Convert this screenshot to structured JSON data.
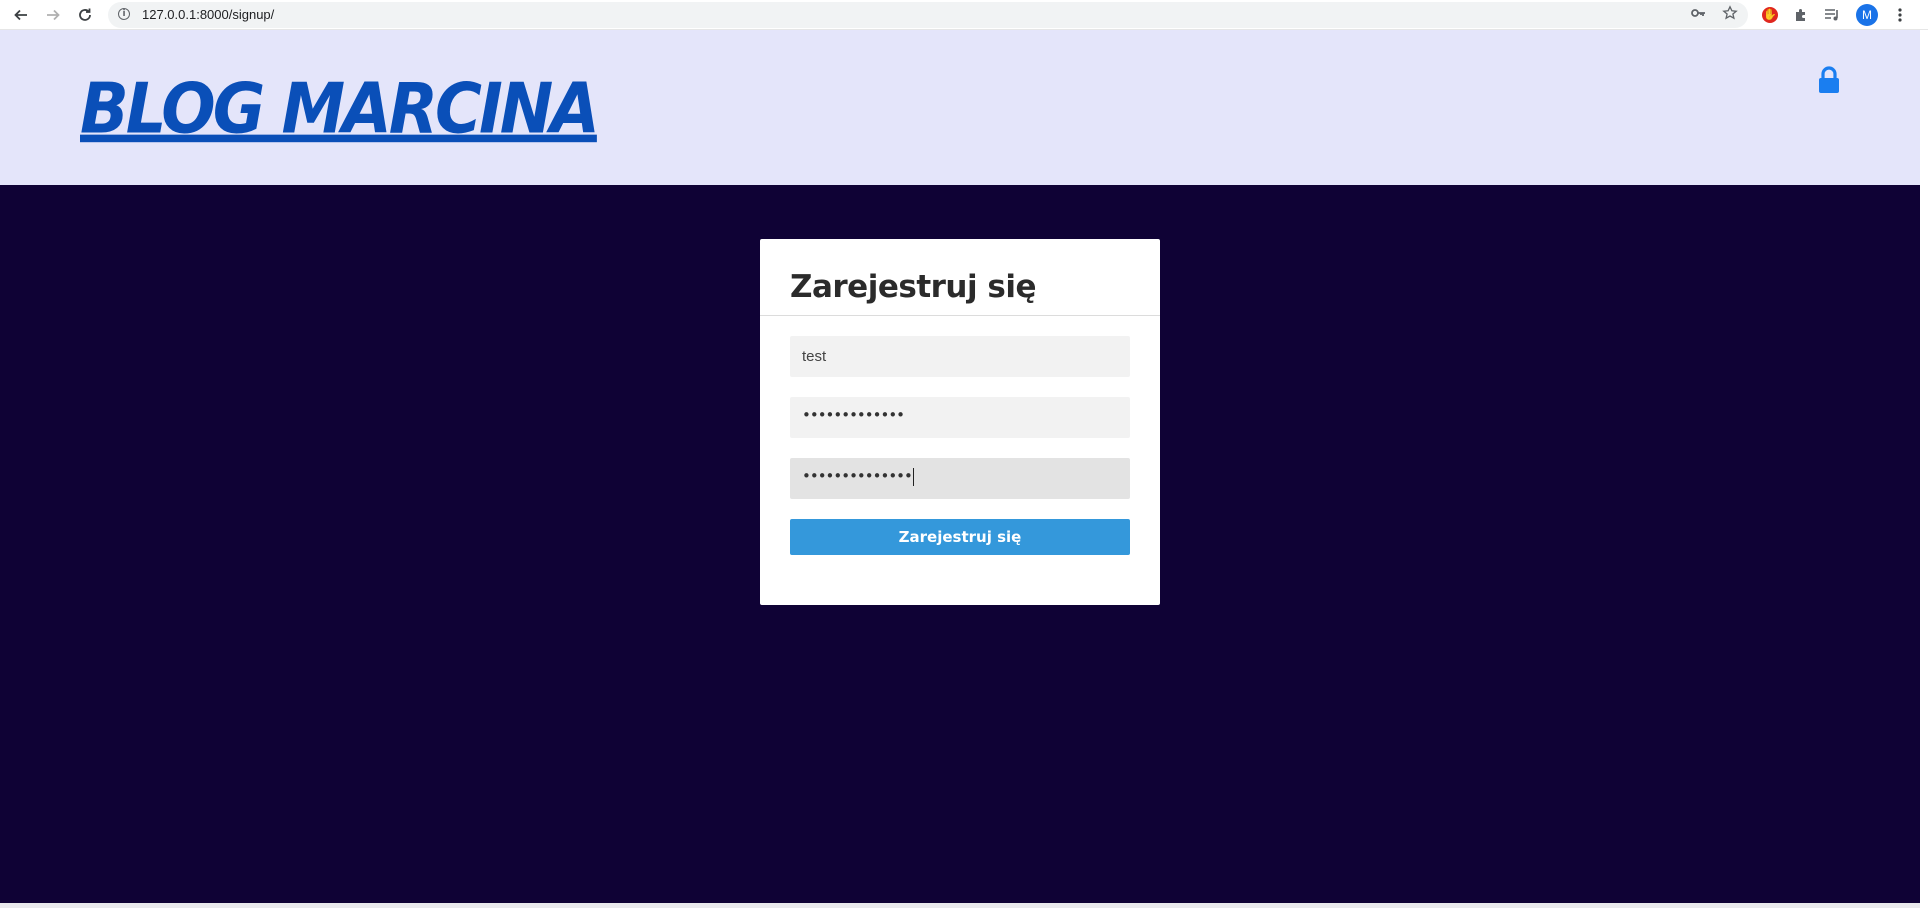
{
  "browser": {
    "url": "127.0.0.1:8000/signup/",
    "back_icon": "arrow-left-icon",
    "forward_icon": "arrow-right-icon",
    "reload_icon": "reload-icon",
    "profile_initial": "M"
  },
  "header": {
    "logo_text": "BLOG MARCINA",
    "lock_icon": "lock-icon",
    "background": "#e4e5fa",
    "logo_color": "#0a4fb8",
    "lock_color": "#1a7ef0"
  },
  "main": {
    "background": "#0f0235"
  },
  "signup_form": {
    "title": "Zarejestruj się",
    "username_value": "test",
    "password_value": "•••••••••••••",
    "password_confirm_value": "••••••••••••••",
    "submit_label": "Zarejestruj się",
    "submit_color": "#3498db"
  }
}
